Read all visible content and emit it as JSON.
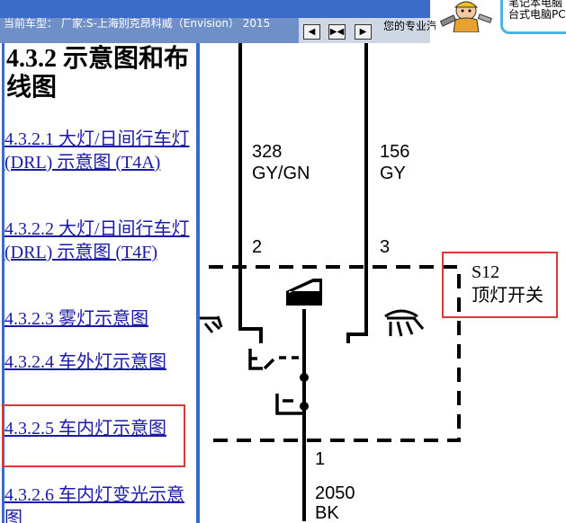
{
  "header": {
    "car_label": "当前车型：  厂家:S-上海别克昂科威（Envision） 2015",
    "nav_buttons": [
      "◀",
      "▶◀",
      "▶"
    ],
    "pro_text": "您的专业汽"
  },
  "promo": {
    "line1": "笔记本电脑",
    "line2": "台式电脑PC"
  },
  "left_nav": {
    "section_title": "4.3.2 示意图和布线图",
    "items": [
      {
        "label": "4.3.2.1 大灯/日间行车灯 (DRL) 示意图 (T4A)"
      },
      {
        "label": "4.3.2.2 大灯/日间行车灯 (DRL) 示意图 (T4F)"
      },
      {
        "label": "4.3.2.3 雾灯示意图"
      },
      {
        "label": "4.3.2.4 车外灯示意图"
      },
      {
        "label": "4.3.2.5 车内灯示意图"
      },
      {
        "label": "4.3.2.6 车内灯变光示意图"
      }
    ]
  },
  "diagram": {
    "wire_left": {
      "circuit": "328",
      "color": "GY/GN",
      "pin": "2"
    },
    "wire_right": {
      "circuit": "156",
      "color": "GY",
      "pin": "3"
    },
    "wire_bottom": {
      "pin": "1",
      "circuit": "2050",
      "color": "BK"
    },
    "component": {
      "id": "S12",
      "name": "顶灯开关"
    }
  },
  "colors": {
    "header_blue": "#3a6bc8",
    "link_blue": "#1a1aa8",
    "highlight_red": "#d83a3a"
  }
}
